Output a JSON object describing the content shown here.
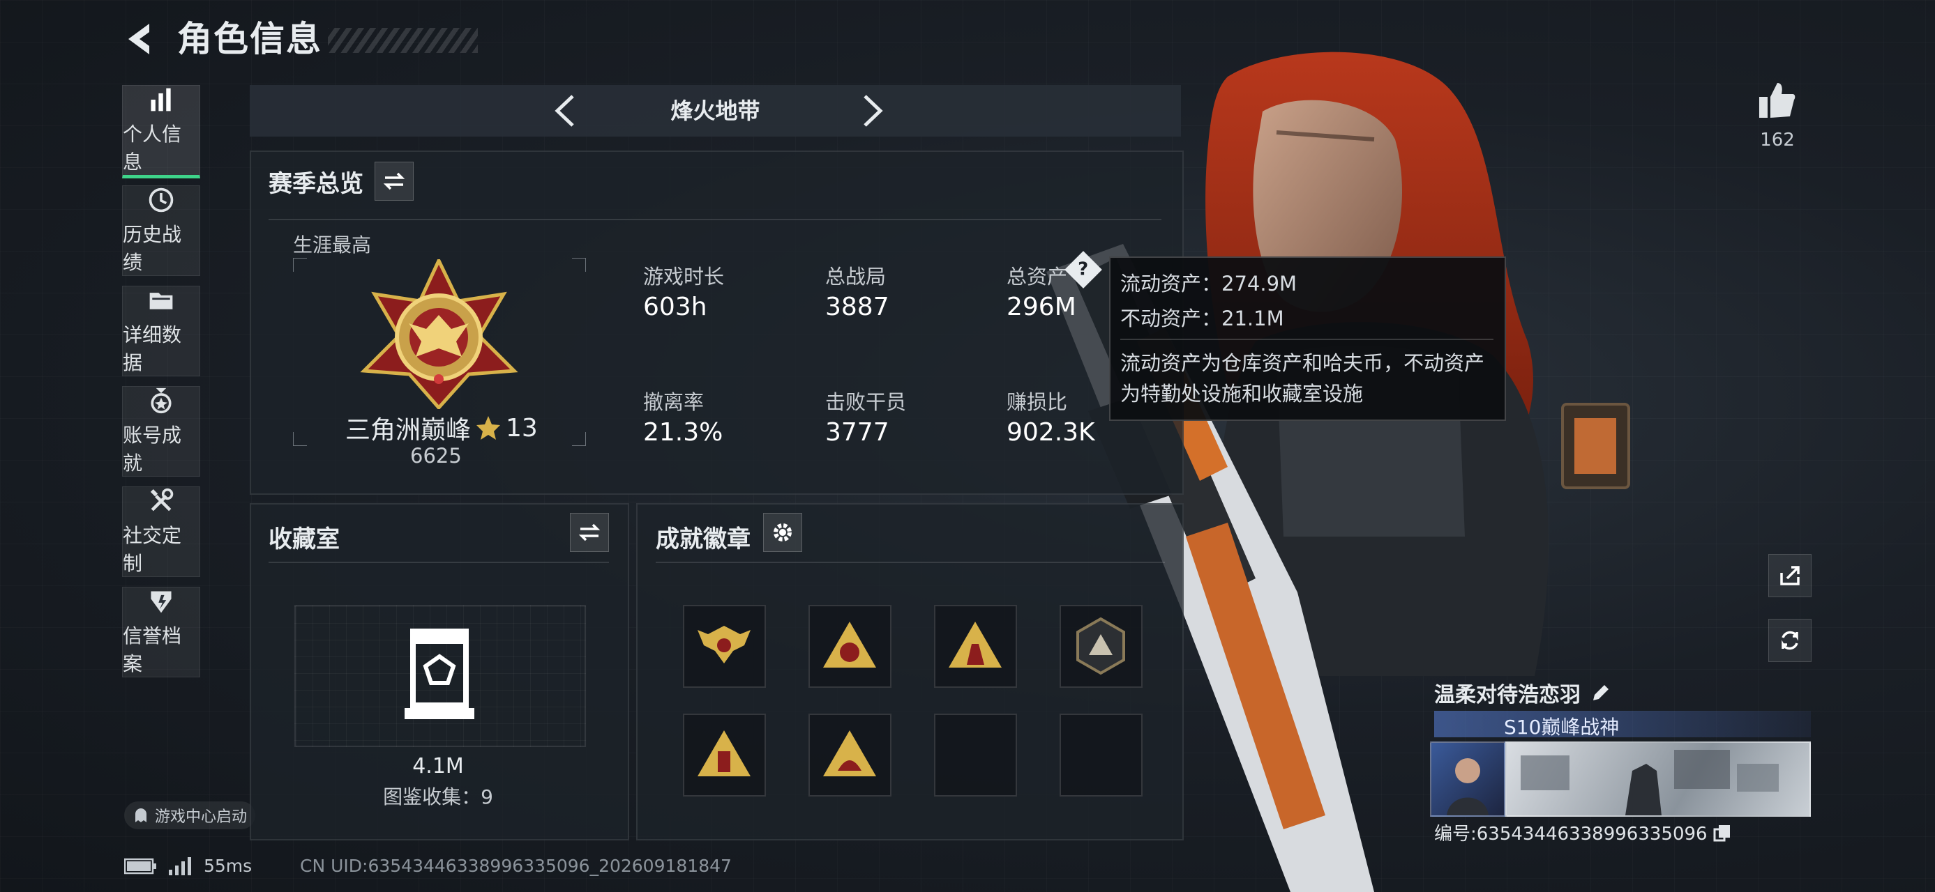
{
  "header": {
    "title": "角色信息"
  },
  "sidebar": {
    "items": [
      {
        "label": "个人信息",
        "icon": "bar-chart-icon",
        "active": true
      },
      {
        "label": "历史战绩",
        "icon": "history-icon"
      },
      {
        "label": "详细数据",
        "icon": "folder-icon"
      },
      {
        "label": "账号成就",
        "icon": "medal-icon"
      },
      {
        "label": "社交定制",
        "icon": "tools-icon"
      },
      {
        "label": "信誉档案",
        "icon": "shield-icon"
      }
    ],
    "game_center": "游戏中心启动"
  },
  "mode": {
    "title": "烽火地带"
  },
  "season": {
    "title": "赛季总览",
    "career_label": "生涯最高",
    "rank_name": "三角洲巅峰",
    "rank_stars": "13",
    "rank_score": "6625",
    "stats": [
      {
        "label": "游戏时长",
        "value": "603h"
      },
      {
        "label": "总战局",
        "value": "3887"
      },
      {
        "label": "总资产",
        "value": "296M"
      },
      {
        "label": "撤离率",
        "value": "21.3%"
      },
      {
        "label": "击败干员",
        "value": "3777"
      },
      {
        "label": "赚损比",
        "value": "902.3K"
      }
    ]
  },
  "tooltip": {
    "line1": "流动资产：274.9M",
    "line2": "不动资产：21.1M",
    "desc1": "流动资产为仓库资产和哈夫币，不动资产",
    "desc2": "为特勤处设施和收藏室设施"
  },
  "collection": {
    "title": "收藏室",
    "value": "4.1M",
    "count_text": "图鉴收集：9"
  },
  "achievements": {
    "title": "成就徽章",
    "badge_count_filled": 6,
    "badge_count_total": 8
  },
  "right": {
    "likes": "162",
    "player_name": "温柔对待浩恋羽",
    "player_title": "S10巅峰战神",
    "player_id": "编号:6354344633899633509​6"
  },
  "footer": {
    "ping": "55ms",
    "uid": "CN UID:63543446338996335096_202609181847"
  },
  "colors": {
    "accent": "#3ed48a",
    "gold": "#d8b24a",
    "bg": "#1a1f26"
  }
}
